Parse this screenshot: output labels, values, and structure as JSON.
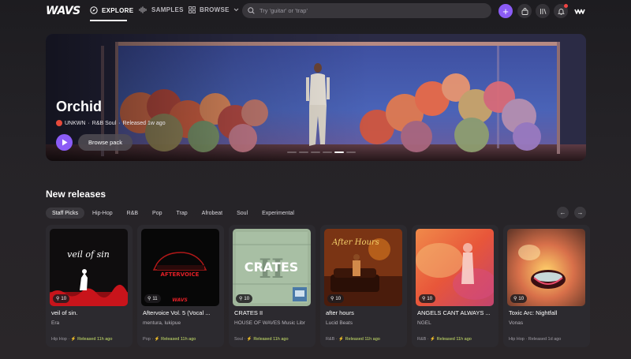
{
  "nav": {
    "logo": "WAVS",
    "links": [
      {
        "label": "EXPLORE",
        "icon": "compass-icon"
      },
      {
        "label": "SAMPLES",
        "icon": "waveform-icon"
      },
      {
        "label": "BROWSE",
        "icon": "grid-icon"
      }
    ],
    "search_placeholder": "Try 'guitar' or 'trap'"
  },
  "hero": {
    "title": "Orchid",
    "artist": "UNKWN",
    "genre": "R&B Soul",
    "released": "Released 1w ago",
    "browse_label": "Browse pack"
  },
  "releases": {
    "title": "New releases",
    "chips": [
      "Staff Picks",
      "Hip-Hop",
      "R&B",
      "Pop",
      "Trap",
      "Afrobeat",
      "Soul",
      "Experimental"
    ],
    "cards": [
      {
        "title": "veil of sin.",
        "artist": "Era",
        "genre": "Hip Hop",
        "released": "Released 11h ago",
        "price": "10"
      },
      {
        "title": "Aftervoice Vol. 5 (Vocal ...",
        "artist": "mentura, lukipue",
        "genre": "Pop",
        "released": "Released 11h ago",
        "price": "11"
      },
      {
        "title": "CRATES II",
        "artist": "HOUSE OF WAVES Music Libr",
        "genre": "Soul",
        "released": "Released 11h ago",
        "price": "10"
      },
      {
        "title": "after hours",
        "artist": "Lucid Beats",
        "genre": "R&B",
        "released": "Released 11h ago",
        "price": "10"
      },
      {
        "title": "ANGELS CANT ALWAYS ...",
        "artist": "NGEL",
        "genre": "R&B",
        "released": "Released 11h ago",
        "price": "10"
      },
      {
        "title": "Toxic Arc: Nightfall",
        "artist": "Vonas",
        "genre": "Hip Hop",
        "released": "Released 1d ago",
        "price": "10"
      }
    ],
    "cover_text": {
      "c1": "veil of sin",
      "c2": "AFTERVOICE",
      "c2b": "WAVS",
      "c3": "CRATES",
      "c3b": "II",
      "c4": "After Hours"
    }
  },
  "colors": {
    "accent": "#8b5cf6",
    "released": "#c8e26a"
  }
}
